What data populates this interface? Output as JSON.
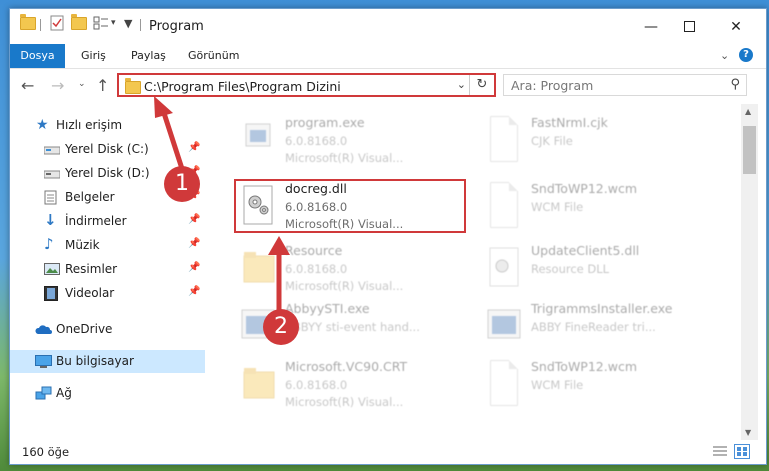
{
  "window": {
    "title": "Program",
    "ribbon_tabs": [
      "Dosya",
      "Giriş",
      "Paylaş",
      "Görünüm"
    ]
  },
  "address": {
    "path": "C:\\Program Files\\Program Dizini",
    "search_placeholder": "Ara: Program"
  },
  "sidebar": {
    "items": [
      {
        "label": "Hızlı erişim",
        "icon": "star-icon"
      },
      {
        "label": "Yerel Disk (C:)",
        "icon": "drive-icon",
        "pinned": true
      },
      {
        "label": "Yerel Disk (D:)",
        "icon": "drive-icon",
        "pinned": true
      },
      {
        "label": "Belgeler",
        "icon": "documents-icon",
        "pinned": true
      },
      {
        "label": "İndirmeler",
        "icon": "download-icon",
        "pinned": true
      },
      {
        "label": "Müzik",
        "icon": "music-icon",
        "pinned": true
      },
      {
        "label": "Resimler",
        "icon": "pictures-icon",
        "pinned": true
      },
      {
        "label": "Videolar",
        "icon": "video-icon",
        "pinned": true
      },
      {
        "label": "OneDrive",
        "icon": "cloud-icon"
      },
      {
        "label": "Bu bilgisayar",
        "icon": "computer-icon"
      },
      {
        "label": "Ağ",
        "icon": "network-icon"
      }
    ]
  },
  "files": [
    {
      "name": "program.exe",
      "l1": "6.0.8168.0",
      "l2": "Microsoft(R) Visual..."
    },
    {
      "name": "FastNrmI.cjk",
      "l1": "CJK File",
      "l2": ""
    },
    {
      "name": "docreg.dll",
      "l1": "6.0.8168.0",
      "l2": "Microsoft(R) Visual..."
    },
    {
      "name": "SndToWP12.wcm",
      "l1": "WCM File",
      "l2": ""
    },
    {
      "name": "Resource",
      "l1": "6.0.8168.0",
      "l2": "Microsoft(R) Visual..."
    },
    {
      "name": "UpdateClient5.dll",
      "l1": "Resource DLL",
      "l2": ""
    },
    {
      "name": "AbbyySTI.exe",
      "l1": "ABBYY sti-event hand...",
      "l2": ""
    },
    {
      "name": "TrigrammsInstaller.exe",
      "l1": "ABBY FineReader tri...",
      "l2": ""
    },
    {
      "name": "Microsoft.VC90.CRT",
      "l1": "6.0.8168.0",
      "l2": "Microsoft(R) Visual..."
    },
    {
      "name": "SndToWP12.wcm",
      "l1": "WCM File",
      "l2": ""
    }
  ],
  "status": {
    "count": "160 öğe"
  },
  "annotations": [
    "1",
    "2"
  ],
  "colors": {
    "accent": "#1979ca",
    "highlight": "#d0393a"
  }
}
